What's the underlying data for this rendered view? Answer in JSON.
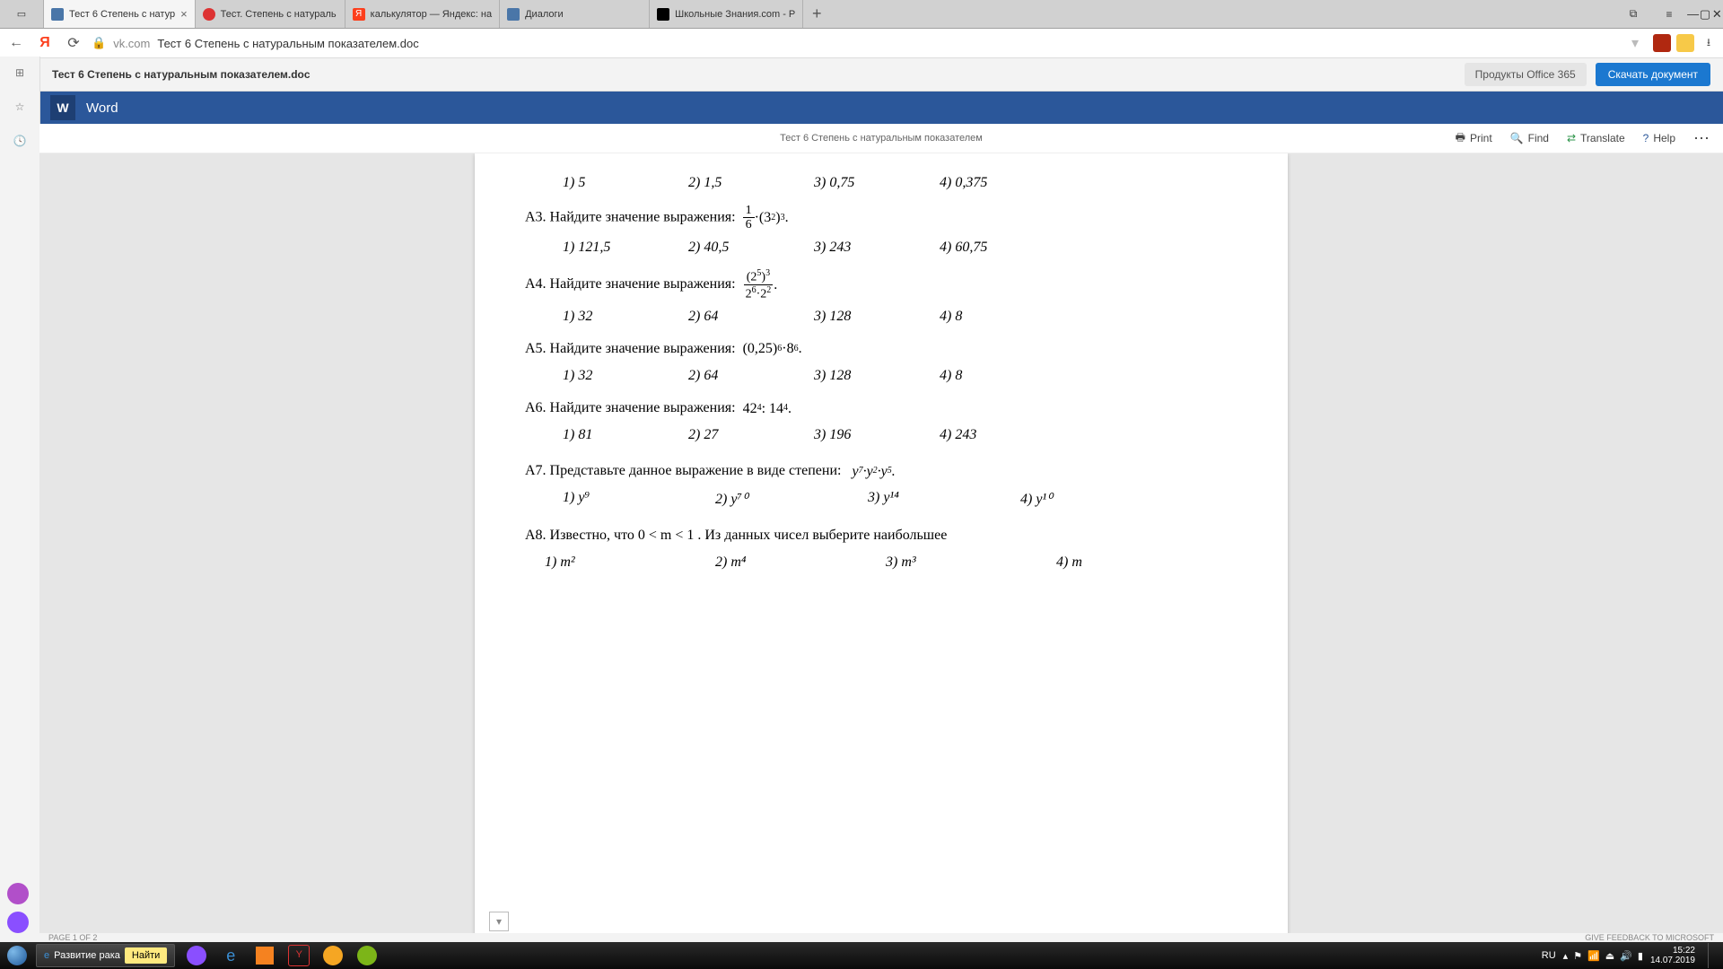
{
  "tabs": [
    {
      "label": "Тест 6 Степень с натур",
      "active": true,
      "icon": "#4a76a8"
    },
    {
      "label": "Тест. Степень с натураль",
      "icon": "#d33"
    },
    {
      "label": "калькулятор — Яндекс: на",
      "icon": "#fc3f1d"
    },
    {
      "label": "Диалоги",
      "icon": "#4a76a8"
    },
    {
      "label": "Школьные Знания.com - Р",
      "icon": "#000"
    }
  ],
  "url": {
    "domain": "vk.com",
    "path": "Тест 6 Степень с натуральным показателем.doc"
  },
  "office": {
    "docname": "Тест 6 Степень с натуральным показателем.doc",
    "products": "Продукты Office 365",
    "download": "Скачать документ"
  },
  "word": {
    "title": "Word"
  },
  "viewer": {
    "title": "Тест 6 Степень с натуральным показателем",
    "print": "Print",
    "find": "Find",
    "translate": "Translate",
    "help": "Help"
  },
  "doc": {
    "q2ans": [
      "1) 5",
      "2) 1,5",
      "3) 0,75",
      "4) 0,375"
    ],
    "q3": "А3. Найдите значение выражения:",
    "q3ans": [
      "1) 121,5",
      "2) 40,5",
      "3) 243",
      "4) 60,75"
    ],
    "q4": "А4. Найдите значение выражения:",
    "q4ans": [
      "1) 32",
      "2) 64",
      "3)  128",
      "4) 8"
    ],
    "q5": "А5. Найдите значение выражения:",
    "q5ans": [
      "1) 32",
      "2) 64",
      "3)  128",
      "4) 8"
    ],
    "q6": "А6. Найдите значение выражения:",
    "q6ans": [
      "1) 81",
      "2) 27",
      "3)  196",
      "4) 243"
    ],
    "q7": "А7. Представьте данное выражение в виде степени:",
    "q7ans": [
      "1)  y⁹",
      "2)  y⁷⁰",
      "3)  y¹⁴",
      "4)  y¹⁰"
    ],
    "q8": "А8. Известно, что   0 < m < 1 .   Из данных чисел выберите наибольшее",
    "q8ans": [
      "1)  m²",
      "2)  m⁴",
      "3)  m³",
      "4)  m"
    ]
  },
  "status": {
    "left": "PAGE 1 OF 2",
    "right": "GIVE FEEDBACK TO MICROSOFT"
  },
  "taskbar": {
    "item1": "Развитие рака",
    "find": "Найти",
    "lang": "RU",
    "time": "15:22",
    "date": "14.07.2019"
  }
}
